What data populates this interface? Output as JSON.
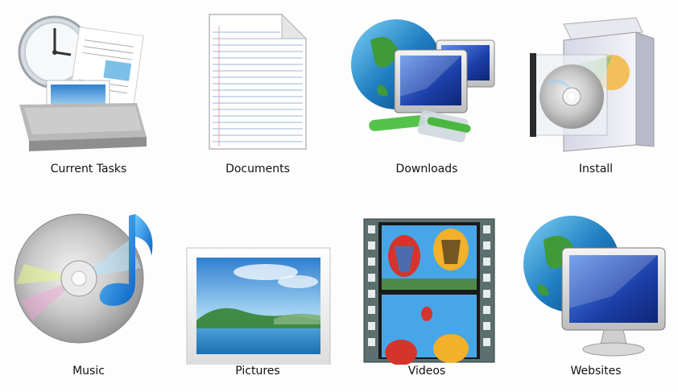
{
  "folders": [
    {
      "label": "Current Tasks",
      "icon": "current-tasks-icon"
    },
    {
      "label": "Documents",
      "icon": "document-icon"
    },
    {
      "label": "Downloads",
      "icon": "network-globe-icon"
    },
    {
      "label": "Install",
      "icon": "software-box-icon"
    },
    {
      "label": "Music",
      "icon": "cd-music-note-icon"
    },
    {
      "label": "Pictures",
      "icon": "picture-frame-icon"
    },
    {
      "label": "Videos",
      "icon": "film-strip-icon"
    },
    {
      "label": "Websites",
      "icon": "globe-monitor-icon"
    }
  ],
  "colors": {
    "label_text": "#111111",
    "background": "#fdfdfd"
  }
}
